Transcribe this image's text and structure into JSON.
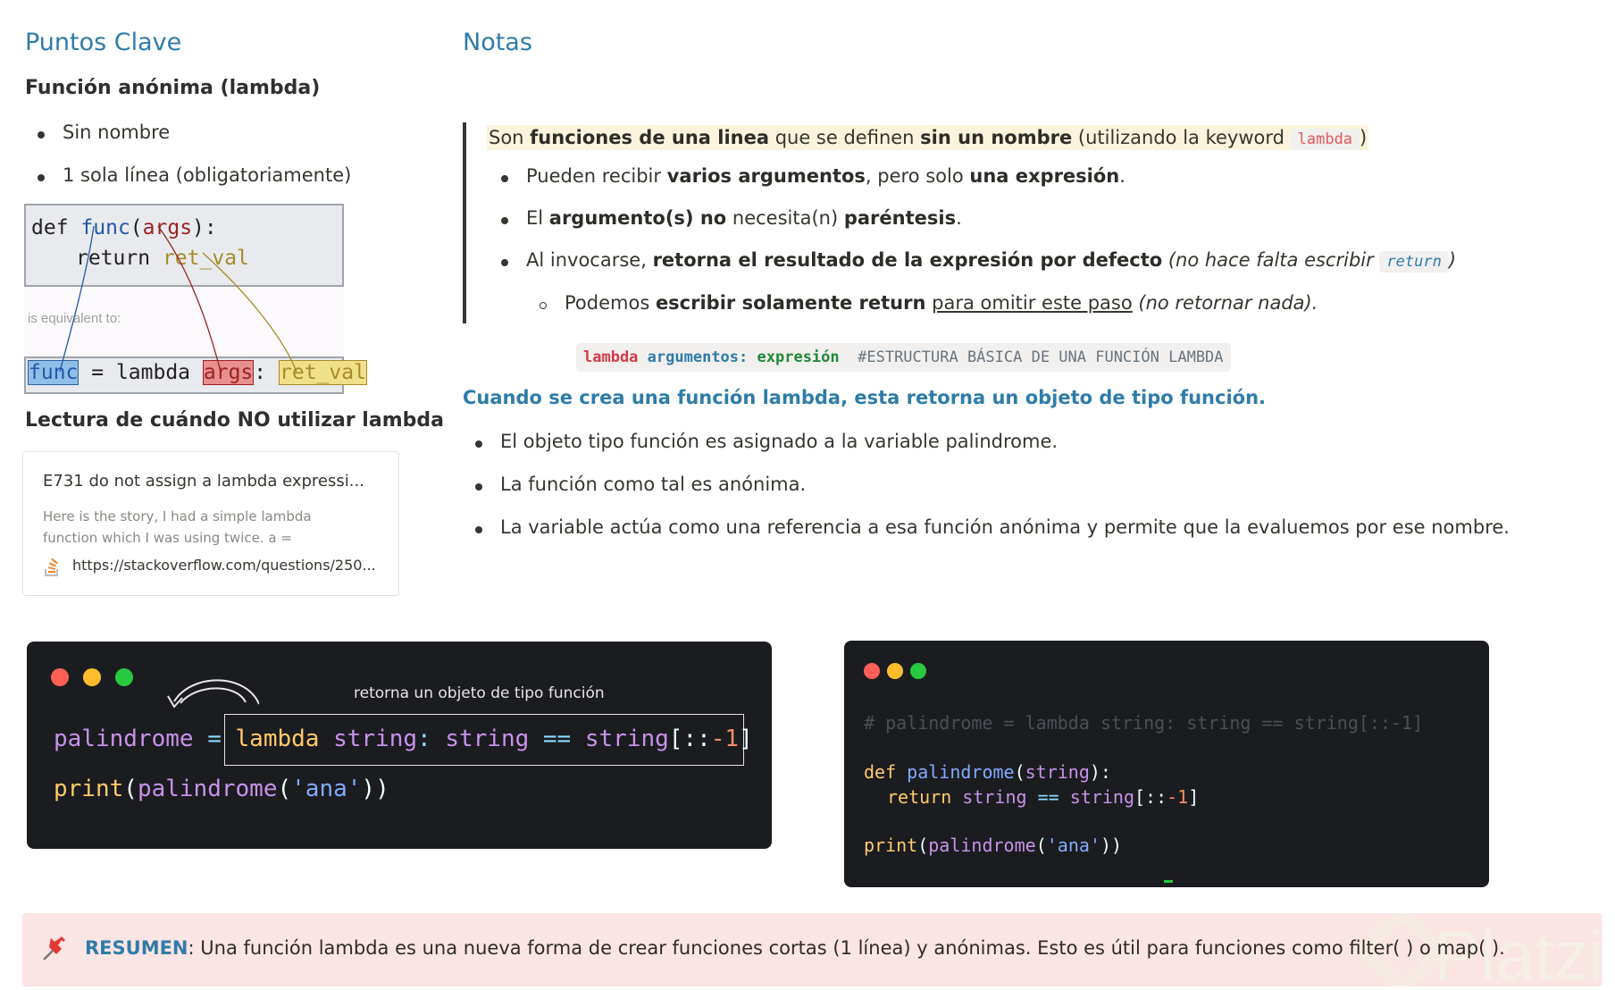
{
  "left": {
    "heading": "Puntos Clave",
    "subheading": "Función anónima (lambda)",
    "bullets": [
      "Sin nombre",
      "1 sola línea (obligatoriamente)"
    ],
    "diagram": {
      "top_line1_def": "def",
      "top_line1_func": "func",
      "top_line1_args": "args",
      "top_line1_paren_open": "(",
      "top_line1_paren_close": "):",
      "top_line2_return": "return",
      "top_line2_retval": "ret_val",
      "equiv_label": "is equivalent to:",
      "bottom_func": "func",
      "bottom_eq": "= lambda",
      "bottom_args": "args",
      "bottom_colon": ":",
      "bottom_retval": "ret_val"
    },
    "reading_heading": "Lectura de cuándo NO utilizar lambda",
    "bookmark": {
      "title": "E731 do not assign a lambda expressi...",
      "desc": "Here is the story, I had a simple lambda function which I was using twice. a =",
      "url": "https://stackoverflow.com/questions/250..."
    }
  },
  "right": {
    "heading": "Notas",
    "quote": {
      "p1": "Son ",
      "b1": "funciones de una linea",
      "p2": " que se definen ",
      "b2": "sin un nombre",
      "p3": " (utilizando la keyword ",
      "code": "lambda",
      "p4": ")"
    },
    "bullets": [
      {
        "t1": "Pueden recibir ",
        "b1": "varios argumentos",
        "t2": ", pero solo ",
        "b2": "una expresión",
        "t3": "."
      },
      {
        "t1": "El ",
        "b1": "argumento(s) no",
        "t2": " necesita(n) ",
        "b2": "paréntesis",
        "t3": "."
      },
      {
        "t1": "Al invocarse, ",
        "b1": "retorna el resultado de la expresión por defecto",
        "i1": " (no hace falta escribir ",
        "code": "return",
        "i2": ")"
      }
    ],
    "sub_bullet": {
      "t1": "Podemos ",
      "b1": "escribir solamente return",
      "u1": "para omitir este paso",
      "i1": " (no retornar nada)."
    },
    "code_block": {
      "kw": "lambda",
      "args": "argumentos:",
      "expr": "expresión",
      "comment": "#ESTRUCTURA BÁSICA DE UNA FUNCIÓN LAMBDA"
    },
    "subheading": "Cuando se crea una función lambda, esta retorna un objeto de tipo función.",
    "bullets2": [
      "El objeto tipo función es asignado a la variable palindrome.",
      "La función como tal es anónima.",
      "La variable actúa como una referencia a esa función anónima y permite que la evaluemos por ese nombre."
    ]
  },
  "terminal1": {
    "annotation": "retorna un objeto de tipo función",
    "line1_var": "palindrome",
    "line1_eq": "=",
    "line1_lambda": "lambda",
    "line1_string": "string",
    "line1_colon": ":",
    "line1_string2": "string",
    "line1_op": "==",
    "line1_string3": "string",
    "line1_slice_a": "[::",
    "line1_neg": "-1",
    "line1_slice_b": "]",
    "line2_print": "print",
    "line2_p1": "(",
    "line2_fn": "palindrome",
    "line2_p2": "(",
    "line2_str": "'ana'",
    "line2_p3": "))"
  },
  "terminal2": {
    "comment": "# palindrome = lambda string: string == string[::-1]",
    "def_kw": "def",
    "def_name": "palindrome",
    "def_p1": "(",
    "def_arg": "string",
    "def_p2": "):",
    "ret_kw": "return",
    "ret_s1": "string",
    "ret_op": "==",
    "ret_s2": "string",
    "ret_sa": "[::",
    "ret_neg": "-1",
    "ret_sb": "]",
    "pr_kw": "print",
    "pr_p1": "(",
    "pr_fn": "palindrome",
    "pr_p2": "(",
    "pr_str": "'ana'",
    "pr_p3": "))"
  },
  "callout": {
    "label": "RESUMEN",
    "text": ": Una función lambda es una nueva forma de crear funciones cortas (1 línea) y anónimas. Esto es útil para funciones como filter( ) o map( ).",
    "watermark": "Platzi"
  },
  "colors": {
    "heading_blue": "#2f7ca8",
    "callout_bg": "#fbe4e4",
    "quote_highlight": "#fbf3db",
    "terminal_bg": "#1b1c1f"
  }
}
